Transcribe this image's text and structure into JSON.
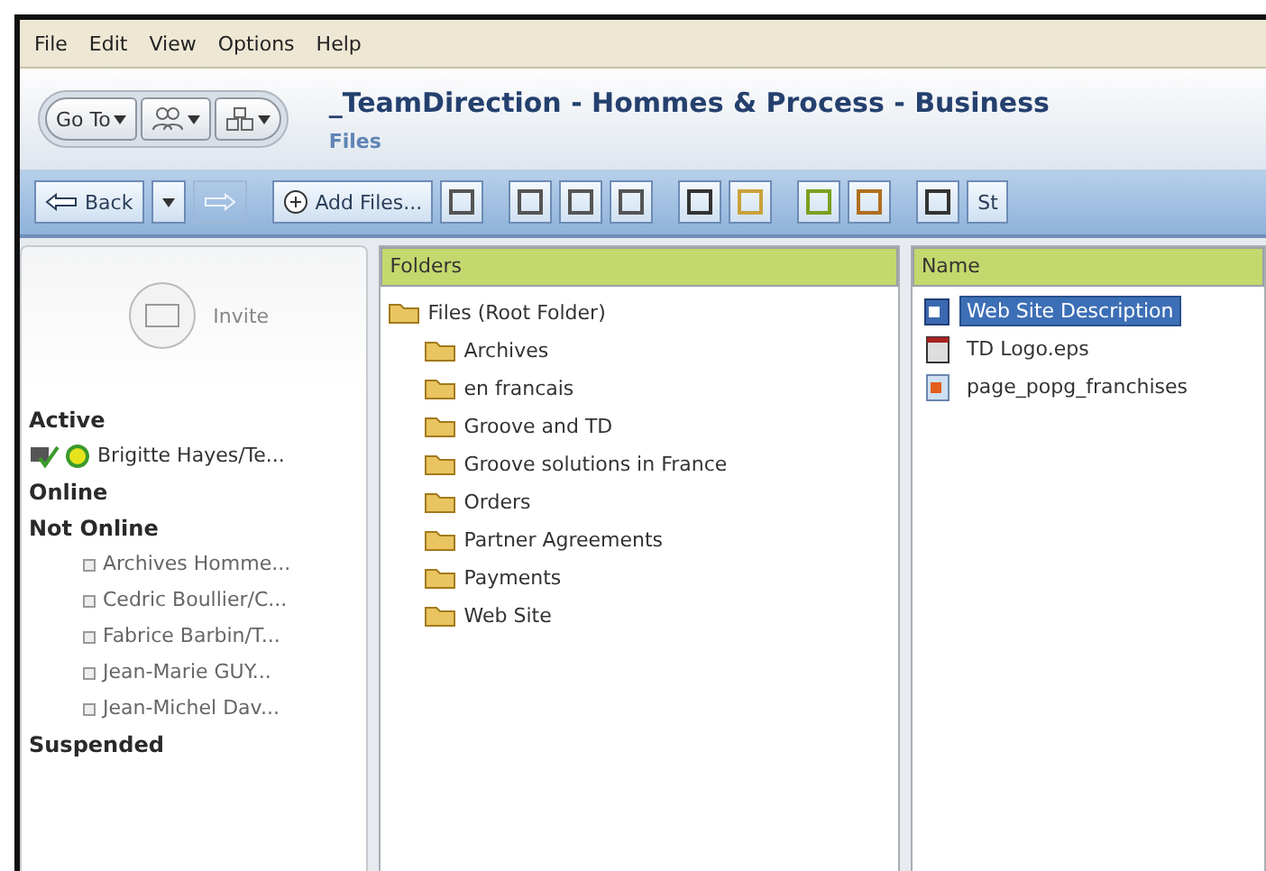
{
  "menu": [
    "File",
    "Edit",
    "View",
    "Options",
    "Help"
  ],
  "header": {
    "go_to": "Go To",
    "title": "_TeamDirection - Hommes & Process - Business",
    "subtitle": "Files"
  },
  "toolbar": {
    "back": "Back",
    "forward_disabled": true,
    "add_files": "Add Files...",
    "cut_label": "St"
  },
  "members": {
    "invite": "Invite",
    "groups": [
      {
        "name": "Active",
        "members": [
          {
            "name": "Brigitte Hayes/Te...",
            "kind": "active"
          }
        ]
      },
      {
        "name": "Online"
      },
      {
        "name": "Not Online",
        "members": [
          {
            "name": "Archives Homme...",
            "kind": "offline"
          },
          {
            "name": "Cedric Boullier/C...",
            "kind": "offline"
          },
          {
            "name": "Fabrice Barbin/T...",
            "kind": "offline"
          },
          {
            "name": "Jean-Marie GUY...",
            "kind": "offline"
          },
          {
            "name": "Jean-Michel Dav...",
            "kind": "offline"
          }
        ]
      },
      {
        "name": "Suspended"
      }
    ]
  },
  "folders": {
    "header": "Folders",
    "tree": {
      "name": "Files (Root Folder)",
      "children": [
        {
          "name": "Archives"
        },
        {
          "name": "en francais"
        },
        {
          "name": "Groove and TD"
        },
        {
          "name": "Groove solutions in France"
        },
        {
          "name": "Orders"
        },
        {
          "name": "Partner Agreements"
        },
        {
          "name": "Payments"
        },
        {
          "name": "Web Site"
        }
      ]
    }
  },
  "files": {
    "header": "Name",
    "items": [
      {
        "name": "Web Site Description",
        "kind": "doc",
        "selected": true
      },
      {
        "name": "TD Logo.eps",
        "kind": "eps",
        "selected": false
      },
      {
        "name": "page_popg_franchises",
        "kind": "image",
        "selected": false
      }
    ]
  }
}
